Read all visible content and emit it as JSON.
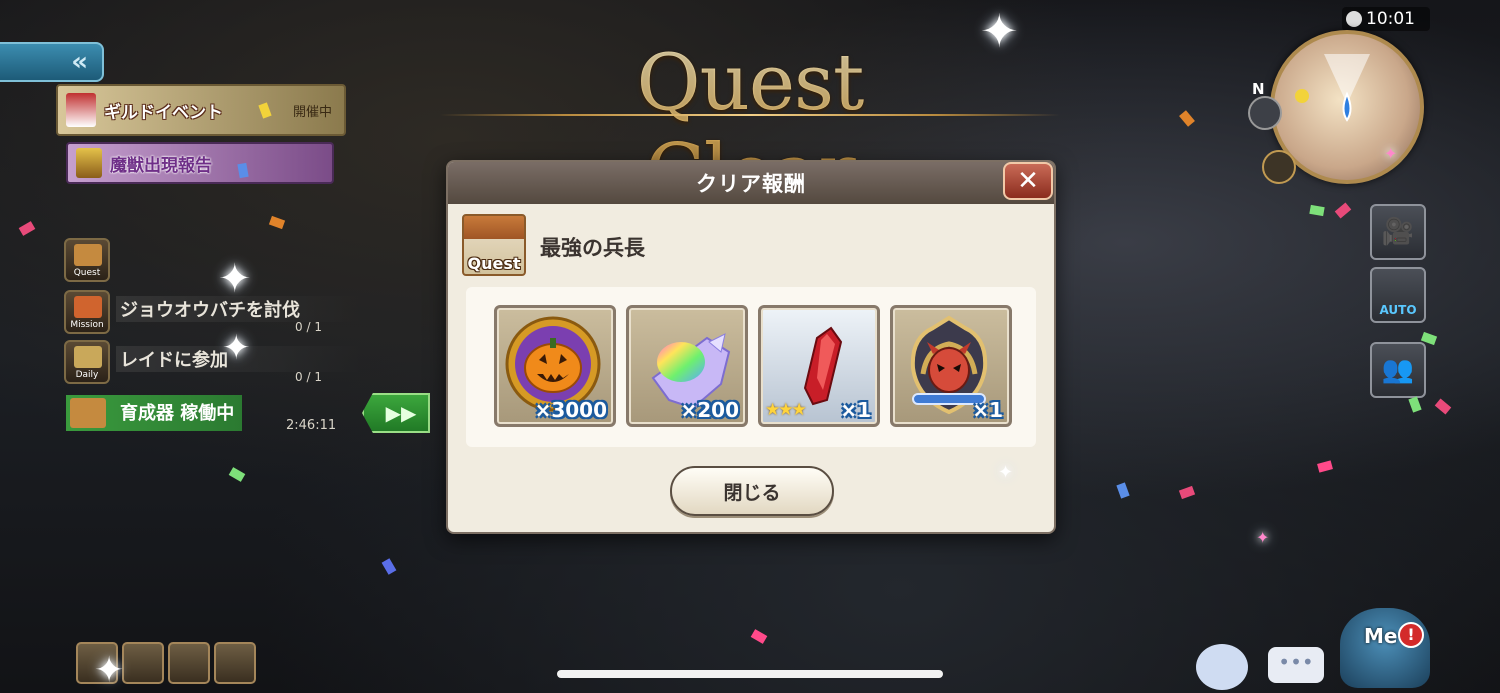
{
  "title": "Quest Clear",
  "status_bar": {
    "time": "10:01"
  },
  "left_panel": {
    "guild_event": {
      "label": "ギルドイベント",
      "status": "開催中"
    },
    "beast_report": {
      "label": "魔獣出現報告"
    },
    "missions": [
      {
        "icon_label": "Quest",
        "text": "",
        "count": ""
      },
      {
        "icon_label": "Mission",
        "text": "ジョウオウバチを討伐",
        "count": "0 / 1"
      },
      {
        "icon_label": "Daily",
        "text": "レイドに参加",
        "count": "0 / 1"
      }
    ],
    "breeder": {
      "text": "育成器 稼働中",
      "time": "2:46:11"
    }
  },
  "dialog": {
    "header": "クリア報酬",
    "quest_icon_label": "Quest",
    "quest_name": "最強の兵長",
    "rewards": [
      {
        "icon": "pumpkin-medal-icon",
        "qty": "×3000"
      },
      {
        "icon": "rainbow-crystal-icon",
        "qty": "×200"
      },
      {
        "icon": "red-crystal-icon",
        "qty": "×1",
        "stars": "★★★"
      },
      {
        "icon": "demon-mask-emblem-icon",
        "qty": "×1"
      }
    ],
    "close_button": "閉じる"
  },
  "right_panel": {
    "compass": "N",
    "auto_label": "AUTO"
  },
  "bottom": {
    "me_label": "Me",
    "alert": "!"
  },
  "colors": {
    "title_gold": "#e9b960",
    "dialog_bg": "#f1ece0",
    "header_bg": "#6a5d55",
    "close_red": "#b0473a",
    "qty_outline": "#1b5a9e"
  }
}
